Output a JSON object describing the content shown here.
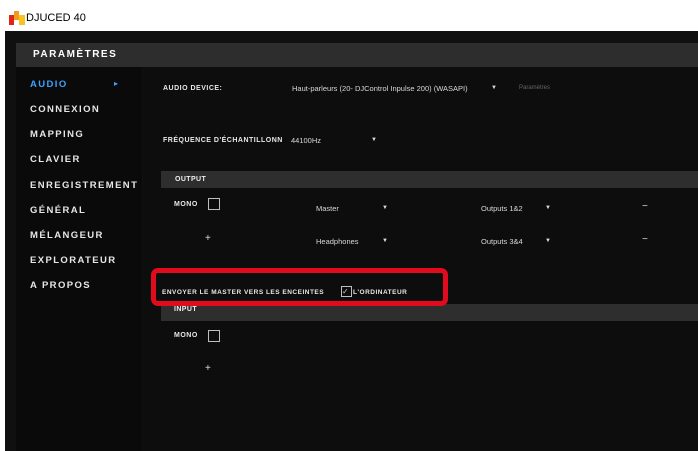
{
  "window": {
    "title": "DJUCED 40"
  },
  "header": {
    "title": "PARAMÈTRES"
  },
  "sidebar": {
    "items": [
      {
        "label": "AUDIO",
        "active": true
      },
      {
        "label": "CONNEXION"
      },
      {
        "label": "MAPPING"
      },
      {
        "label": "CLAVIER"
      },
      {
        "label": "ENREGISTREMENT"
      },
      {
        "label": "GÉNÉRAL"
      },
      {
        "label": "MÉLANGEUR"
      },
      {
        "label": "EXPLORATEUR"
      },
      {
        "label": "A PROPOS"
      }
    ]
  },
  "audio_device": {
    "label": "AUDIO DEVICE:",
    "value": "Haut-parleurs (20- DJControl Inpulse 200) (WASAPI)",
    "settings_link": "Paramètres"
  },
  "sample_rate": {
    "label": "FRÉQUENCE D'ÉCHANTILLONN",
    "value": "44100Hz"
  },
  "output": {
    "header": "OUTPUT",
    "mono_label": "MONO",
    "rows": [
      {
        "channel": "Master",
        "outputs": "Outputs 1&2"
      },
      {
        "channel": "Headphones",
        "outputs": "Outputs 3&4"
      }
    ],
    "minus": "−",
    "plus": "+"
  },
  "send_master": {
    "label": "ENVOYER LE MASTER VERS LES ENCEINTES",
    "suffix": "L'ORDINATEUR",
    "checked": true
  },
  "input": {
    "header": "INPUT",
    "mono_label": "MONO",
    "plus": "+"
  },
  "colors": {
    "accent": "#3da3ff",
    "highlight": "#e10b1d"
  }
}
